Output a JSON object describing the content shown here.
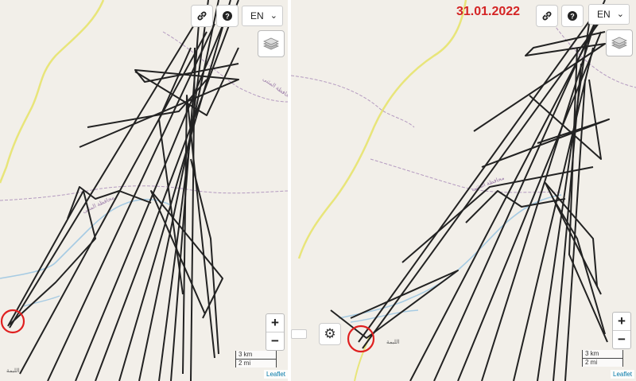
{
  "left_map": {
    "lang_label": "EN",
    "place_label_bottom": "اللبمة",
    "region_label": "محافظة المثنى",
    "scale_km": "3 km",
    "scale_mi": "2 mi",
    "zoom_in": "+",
    "zoom_out": "−",
    "attribution": "Leaflet",
    "icons": [
      "link-icon",
      "help-icon",
      "layers-icon",
      "chevron-down-icon"
    ]
  },
  "right_map": {
    "date": "31.01.2022",
    "lang_label": "EN",
    "place_label_bottom": "اللبمة",
    "region_label": "محافظة المثنى",
    "scale_km": "3 km",
    "scale_mi": "2 mi",
    "zoom_in": "+",
    "zoom_out": "−",
    "attribution": "Leaflet",
    "icons": [
      "link-icon",
      "help-icon",
      "layers-icon",
      "gear-icon",
      "chevron-down-icon"
    ]
  },
  "colors": {
    "map_background": "#f2efe9",
    "track": "#222222",
    "river": "#a6cbe3",
    "road": "#e8e57a",
    "boundary": "#b49ac0",
    "highlight_circle": "#e02020",
    "date_text": "#d42424"
  }
}
